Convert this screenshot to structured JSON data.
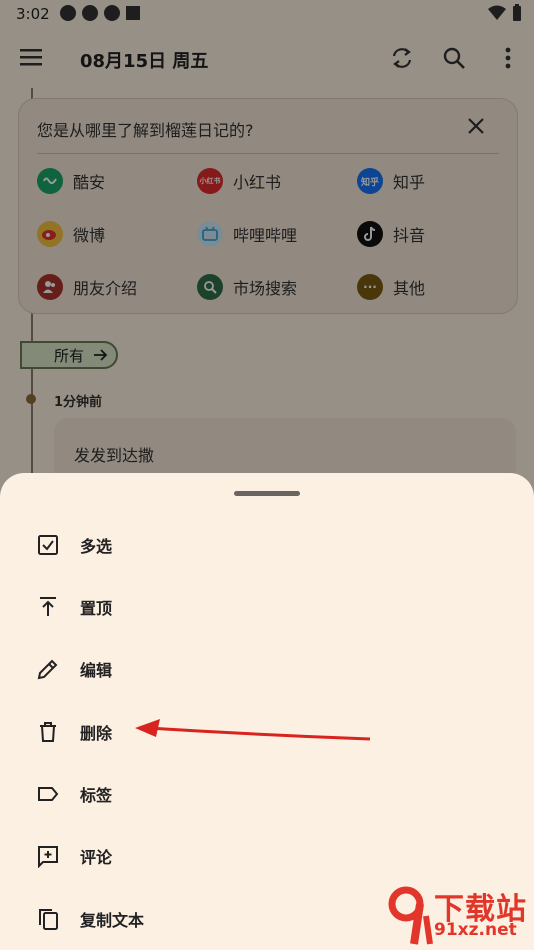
{
  "status_bar": {
    "time": "3:02"
  },
  "topbar": {
    "title": "08月15日 周五"
  },
  "survey": {
    "question": "您是从哪里了解到榴莲日记的?",
    "options": [
      {
        "label": "酷安",
        "icon": "coolapk-icon",
        "color": "#1aa56a",
        "glyph": ""
      },
      {
        "label": "小红书",
        "icon": "xiaohongshu-icon",
        "color": "#e02b2b",
        "glyph": "小红书"
      },
      {
        "label": "知乎",
        "icon": "zhihu-icon",
        "color": "#1772f6",
        "glyph": "知乎"
      },
      {
        "label": "微博",
        "icon": "weibo-icon",
        "color": "#f5c242",
        "glyph": ""
      },
      {
        "label": "哔哩哔哩",
        "icon": "bilibili-icon",
        "color": "#7ccbf0",
        "glyph": ""
      },
      {
        "label": "抖音",
        "icon": "douyin-icon",
        "color": "#111111",
        "glyph": ""
      },
      {
        "label": "朋友介绍",
        "icon": "friends-icon",
        "color": "#a8322b",
        "glyph": ""
      },
      {
        "label": "市场搜索",
        "icon": "search-market-icon",
        "color": "#2f6f4a",
        "glyph": ""
      },
      {
        "label": "其他",
        "icon": "more-icon",
        "color": "#7a5a12",
        "glyph": "···"
      }
    ]
  },
  "filter_chip": {
    "label": "所有"
  },
  "timeline": {
    "time_label": "1分钟前",
    "note_text": "发发到达撒"
  },
  "sheet": {
    "items": [
      {
        "label": "多选",
        "icon": "checkbox-icon"
      },
      {
        "label": "置顶",
        "icon": "pin-top-icon"
      },
      {
        "label": "编辑",
        "icon": "pencil-icon"
      },
      {
        "label": "删除",
        "icon": "trash-icon"
      },
      {
        "label": "标签",
        "icon": "label-icon"
      },
      {
        "label": "评论",
        "icon": "comment-add-icon"
      },
      {
        "label": "复制文本",
        "icon": "copy-icon"
      }
    ]
  },
  "watermark": {
    "text": "下载站",
    "domain": "91xz.net"
  },
  "colors": {
    "accent_red": "#e02b2b",
    "sheet_bg": "#fcf0e3",
    "chip_border": "#6d7a55"
  }
}
